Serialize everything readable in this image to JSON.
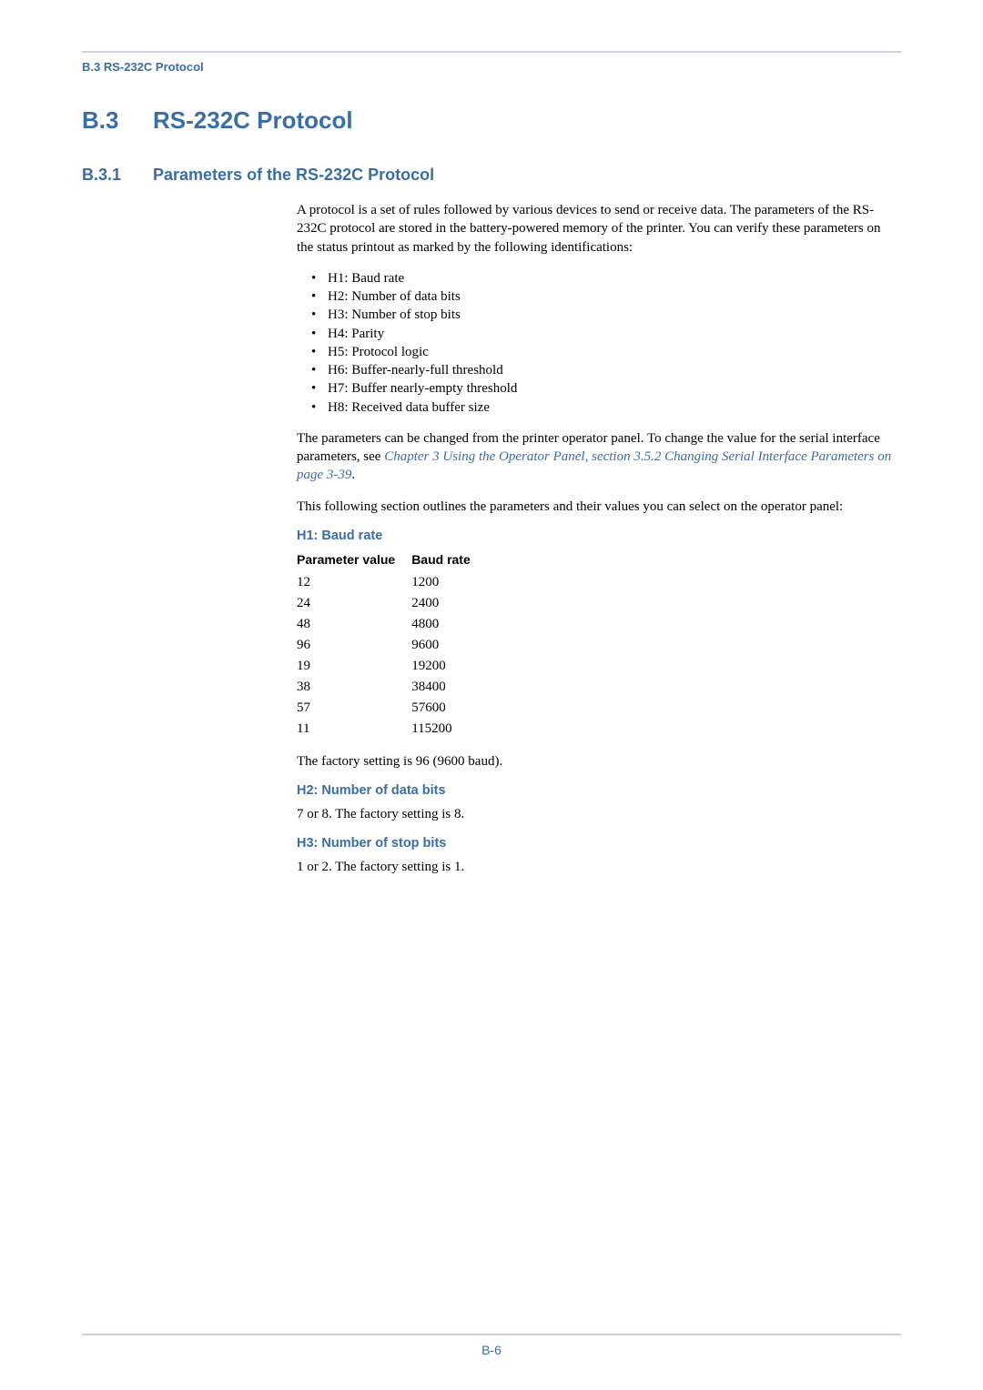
{
  "header": {
    "section_label": "B.3 RS-232C Protocol"
  },
  "h1": {
    "num": "B.3",
    "title": "RS-232C Protocol"
  },
  "h2": {
    "num": "B.3.1",
    "title": "Parameters of the RS-232C Protocol"
  },
  "intro": "A protocol is a set of rules followed by various devices to send or receive data. The parameters of the RS-232C protocol are stored in the battery-powered memory of the printer. You can verify these parameters on the status printout as marked by the following identifications:",
  "identifications": [
    "H1: Baud rate",
    "H2: Number of data bits",
    "H3: Number of stop bits",
    "H4: Parity",
    "H5: Protocol logic",
    "H6: Buffer-nearly-full threshold",
    "H7: Buffer nearly-empty threshold",
    "H8: Received data buffer size"
  ],
  "para2_pre": "The parameters can be changed from the printer operator panel. To change the value for the serial interface parameters, see ",
  "para2_link": "Chapter 3 Using the Operator Panel, section 3.5.2 Changing Serial Interface Parameters on page 3-39",
  "para2_post": ".",
  "para3": "This following section outlines the parameters and their values you can select on the operator panel:",
  "h1_section": {
    "heading": "H1: Baud rate",
    "col_param": "Parameter value",
    "col_baud": "Baud rate"
  },
  "chart_data": {
    "type": "table",
    "title": "H1: Baud rate",
    "columns": [
      "Parameter value",
      "Baud rate"
    ],
    "rows": [
      {
        "param": "12",
        "baud": "1200"
      },
      {
        "param": "24",
        "baud": "2400"
      },
      {
        "param": "48",
        "baud": "4800"
      },
      {
        "param": "96",
        "baud": "9600"
      },
      {
        "param": "19",
        "baud": "19200"
      },
      {
        "param": "38",
        "baud": "38400"
      },
      {
        "param": "57",
        "baud": "57600"
      },
      {
        "param": "11",
        "baud": "115200"
      }
    ]
  },
  "h1_note": "The factory setting is 96 (9600 baud).",
  "h2_section": {
    "heading": "H2: Number of data bits",
    "text": "7 or 8. The factory setting is 8."
  },
  "h3_section": {
    "heading": "H3: Number of stop bits",
    "text": "1 or 2. The factory setting is 1."
  },
  "footer": {
    "page": "B-6"
  }
}
